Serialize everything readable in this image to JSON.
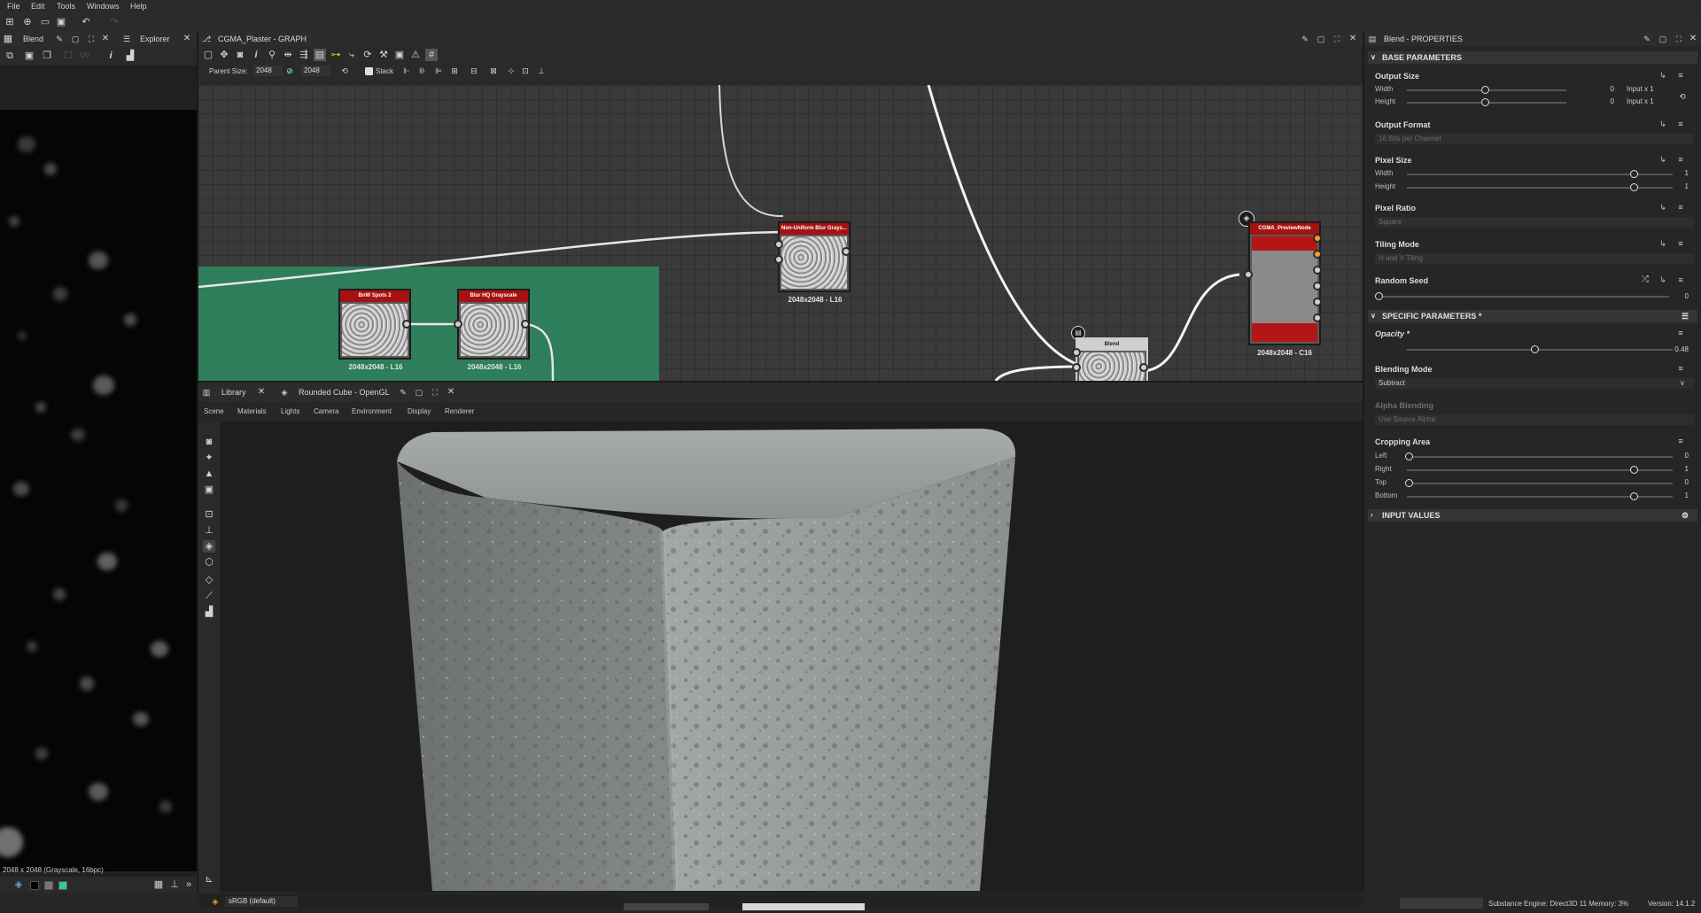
{
  "menu": [
    "File",
    "Edit",
    "Tools",
    "Windows",
    "Help"
  ],
  "left_panel": {
    "tabs": [
      "Blend",
      "Explorer"
    ],
    "uv_label": "UV",
    "footer_info": "2048 x 2048 (Grayscale, 16bpc)"
  },
  "graph": {
    "title": "CGMA_Plaster - GRAPH",
    "parent_size_label": "Parent Size:",
    "parent_size_value": "2048",
    "size_value": "2048",
    "stack_label": "Stack",
    "nodes": [
      {
        "title": "BnW Spots 2",
        "label": "2048x2048 - L16"
      },
      {
        "title": "Blur HQ Grayscale",
        "label": "2048x2048 - L16"
      },
      {
        "title": "Non-Uniform Blur Grays...",
        "label": "2048x2048 - L16"
      },
      {
        "title": "Blend",
        "label": ""
      },
      {
        "title": "CGMA_PreviewNode",
        "label": "2048x2048 - C16"
      }
    ]
  },
  "view3d": {
    "tabs": [
      "Library",
      "Rounded Cube - OpenGL"
    ],
    "menu": [
      "Scene",
      "Materials",
      "Lights",
      "Camera",
      "Environment",
      "Display",
      "Renderer"
    ],
    "colorspace": "sRGB (default)"
  },
  "properties": {
    "title": "Blend - PROPERTIES",
    "base_section": "BASE PARAMETERS",
    "output_size": {
      "label": "Output Size",
      "width_label": "Width",
      "height_label": "Height",
      "width_value": "0",
      "height_value": "0",
      "width_mode": "Input x 1",
      "height_mode": "Input x 1"
    },
    "output_format": {
      "label": "Output Format",
      "value": "16 Bits per Channel"
    },
    "pixel_size": {
      "label": "Pixel Size",
      "width_label": "Width",
      "height_label": "Height",
      "width_value": "1",
      "height_value": "1"
    },
    "pixel_ratio": {
      "label": "Pixel Ratio",
      "value": "Square"
    },
    "tiling_mode": {
      "label": "Tiling Mode",
      "value": "H and V Tiling"
    },
    "random_seed": {
      "label": "Random Seed",
      "value": "0"
    },
    "specific_section": "SPECIFIC PARAMETERS *",
    "opacity": {
      "label": "Opacity *",
      "value": "0.48",
      "fraction": 0.48
    },
    "blending_mode": {
      "label": "Blending Mode",
      "value": "Subtract"
    },
    "alpha_blending": {
      "label": "Alpha Blending",
      "value": "Use Source Alpha"
    },
    "cropping": {
      "label": "Cropping Area",
      "left_label": "Left",
      "right_label": "Right",
      "top_label": "Top",
      "bottom_label": "Bottom",
      "left": "0",
      "right": "1",
      "top": "0",
      "bottom": "1"
    },
    "input_section": "INPUT VALUES"
  },
  "status": {
    "engine": "Substance Engine: Direct3D 11  Memory: 3%",
    "version": "Version: 14.1.2"
  },
  "colors": {
    "node_header": "#a61111",
    "graph_frame": "#2e7d5b",
    "accent_port": "#f0a020"
  }
}
